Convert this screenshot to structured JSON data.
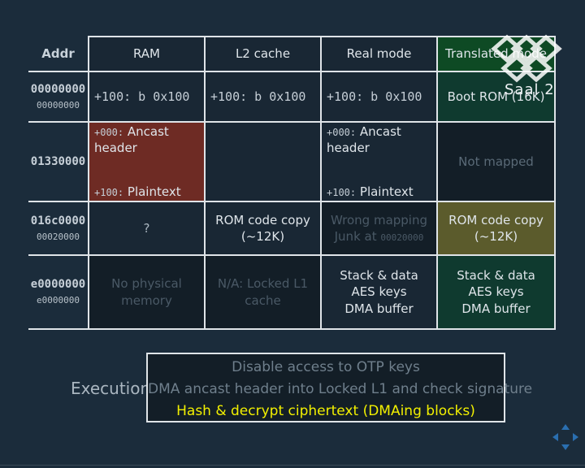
{
  "table": {
    "addr_header": "Addr",
    "columns": [
      "RAM",
      "L2 cache",
      "Real mode",
      "Translated mode"
    ],
    "rows": [
      {
        "addr": "00000000",
        "sub": "00000000",
        "ram": "+100: b 0x100",
        "l2": "+100: b 0x100",
        "real": "+100: b 0x100",
        "translated": "Boot ROM (16K)"
      },
      {
        "addr": "01330000",
        "ram_off1": "+000:",
        "ram_txt1": "Ancast header",
        "ram_off2": "+100:",
        "ram_txt2": "Plaintext",
        "real_off1": "+000:",
        "real_txt1": "Ancast header",
        "real_off2": "+100:",
        "real_txt2": "Plaintext",
        "translated": "Not mapped"
      },
      {
        "addr": "016c0000",
        "sub": "00020000",
        "ram": "?",
        "l2_1": "ROM code copy",
        "l2_2": "(~12K)",
        "real_1": "Wrong mapping",
        "real_2": "Junk at",
        "real_2b": "00020000",
        "tr_1": "ROM code copy",
        "tr_2": "(~12K)"
      },
      {
        "addr": "e0000000",
        "sub": "e0000000",
        "ram": "No physical memory",
        "l2": "N/A: Locked L1 cache",
        "real_1": "Stack & data",
        "real_2": "AES keys",
        "real_3": "DMA buffer",
        "tr_1": "Stack & data",
        "tr_2": "AES keys",
        "tr_3": "DMA buffer"
      }
    ]
  },
  "execution": {
    "label": "Execution:",
    "steps": [
      "Disable access to OTP keys",
      "DMA ancast header into Locked L1 and check signature",
      "Hash & decrypt ciphertext (DMAing blocks)"
    ],
    "active_step": 2
  },
  "overlay": {
    "logo_text": "Saal 2",
    "logo_icon": "ccc-cube-logo-icon",
    "nav_icon": "four-arrows-nav-icon"
  },
  "colors": {
    "background": "#1b2c3b",
    "translated_header": "#0e4a24",
    "ram_highlight": "#6e2b24",
    "rom_copy_highlight": "#5b5b2c",
    "active_step": "#f2f000"
  }
}
